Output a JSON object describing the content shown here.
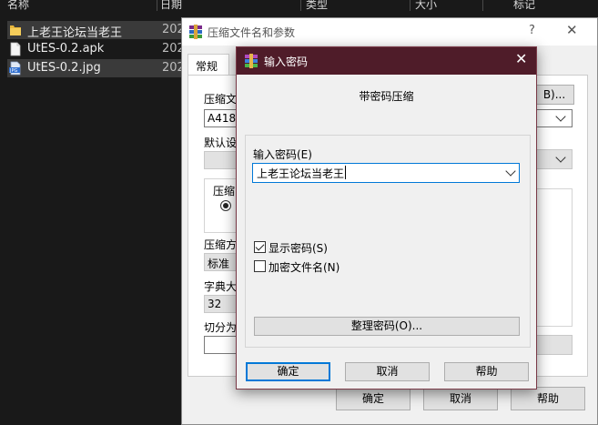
{
  "explorer": {
    "columns": [
      "名称",
      "日期",
      "类型",
      "大小",
      "标记"
    ],
    "files": [
      {
        "name": "上老王论坛当老王",
        "date": "202",
        "icon": "folder-icon"
      },
      {
        "name": "UtES-0.2.apk",
        "date": "202",
        "icon": "file-icon"
      },
      {
        "name": "UtES-0.2.jpg",
        "date": "202",
        "icon": "jpg-icon"
      }
    ]
  },
  "archive_dialog": {
    "title": "压缩文件名和参数",
    "help": "?",
    "close": "✕",
    "tab": "常规",
    "labels": {
      "archive_name": "压缩文",
      "archive_name_value": "A4185",
      "browse": "B)...",
      "default_profile": "默认设",
      "archive_format": "压缩",
      "method": "压缩方",
      "method_value": "标准",
      "dict_size": "字典大",
      "dict_value": "32",
      "split": "切分为"
    },
    "buttons": {
      "ok": "确定",
      "cancel": "取消",
      "help": "帮助"
    }
  },
  "password_dialog": {
    "title": "输入密码",
    "close": "✕",
    "heading": "带密码压缩",
    "input_label": "输入密码(E)",
    "password_value": "上老王论坛当老王",
    "show_password": {
      "label": "显示密码(S)",
      "checked": true
    },
    "encrypt_names": {
      "label": "加密文件名(N)",
      "checked": false
    },
    "organize": "整理密码(O)...",
    "buttons": {
      "ok": "确定",
      "cancel": "取消",
      "help": "帮助"
    }
  },
  "colors": {
    "title_bar": "#4f1c29",
    "accent": "#0078d7"
  }
}
